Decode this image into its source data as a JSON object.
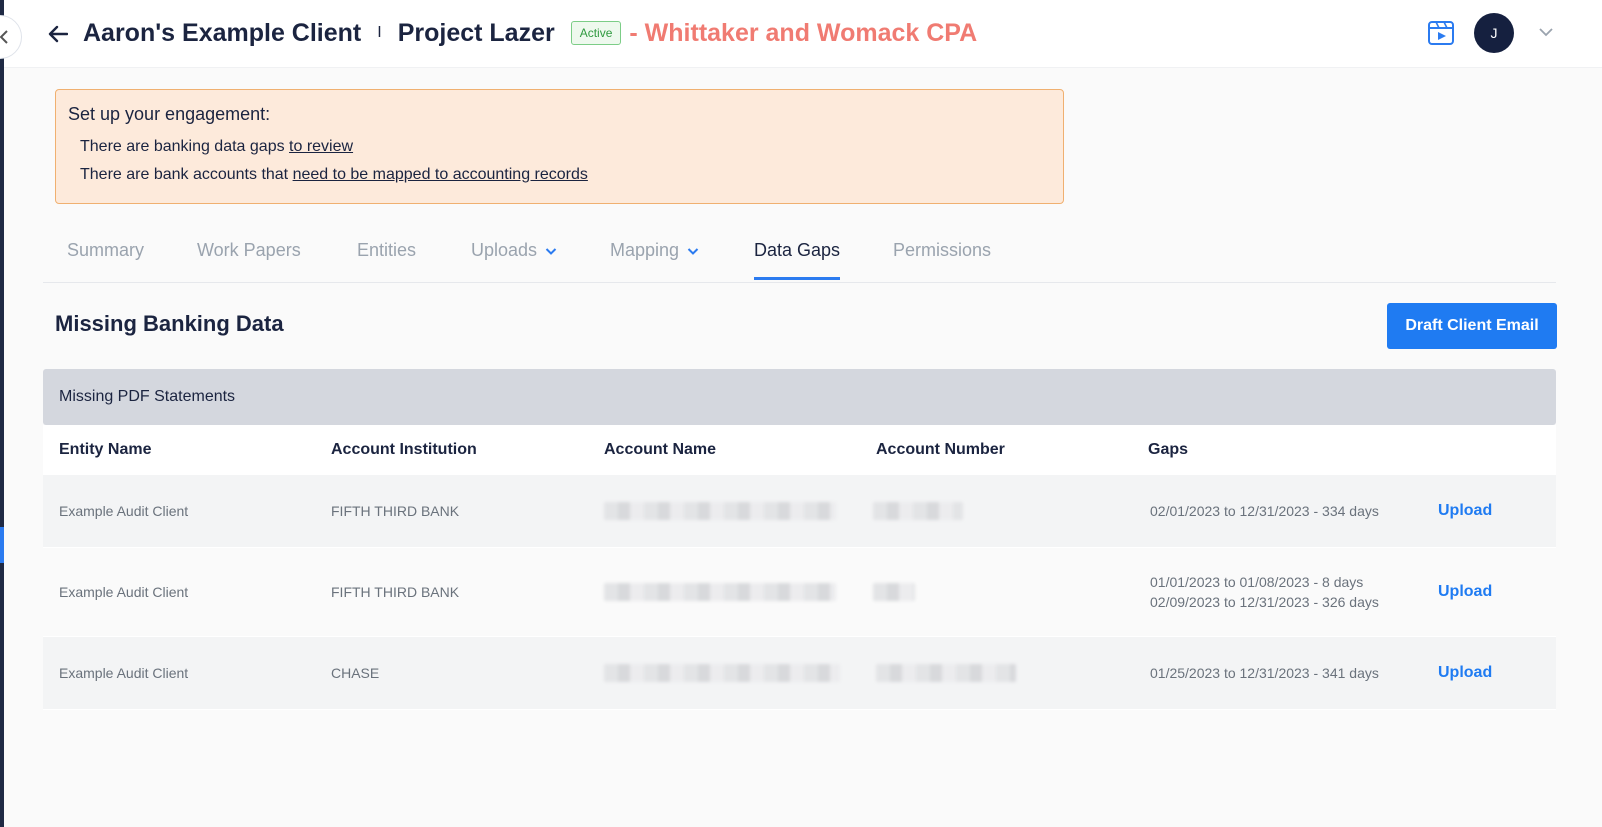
{
  "header": {
    "client_name": "Aaron's Example Client",
    "separator": "I",
    "project_name": "Project Lazer",
    "status": "Active",
    "firm_name": "- Whittaker and Womack CPA",
    "avatar_initial": "J"
  },
  "setup": {
    "title": "Set up your engagement:",
    "line1_prefix": "There are banking data gaps ",
    "line1_link": "to review",
    "line2_prefix": "There are bank accounts that ",
    "line2_link": "need to be mapped to accounting records"
  },
  "tabs": [
    {
      "label": "Summary"
    },
    {
      "label": "Work Papers"
    },
    {
      "label": "Entities"
    },
    {
      "label": "Uploads"
    },
    {
      "label": "Mapping"
    },
    {
      "label": "Data Gaps"
    },
    {
      "label": "Permissions"
    }
  ],
  "active_tab": "Data Gaps",
  "main": {
    "section_title": "Missing Banking Data",
    "draft_button": "Draft Client Email",
    "group_title": "Missing PDF Statements",
    "columns": [
      "Entity Name",
      "Account Institution",
      "Account Name",
      "Account Number",
      "Gaps"
    ],
    "rows": [
      {
        "entity": "Example Audit Client",
        "institution": "FIFTH THIRD BANK",
        "gaps": [
          "02/01/2023 to 12/31/2023 - 334 days"
        ],
        "action": "Upload"
      },
      {
        "entity": "Example Audit Client",
        "institution": "FIFTH THIRD BANK",
        "gaps": [
          "01/01/2023 to 01/08/2023 - 8 days",
          "02/09/2023 to 12/31/2023 - 326 days"
        ],
        "action": "Upload"
      },
      {
        "entity": "Example Audit Client",
        "institution": "CHASE",
        "gaps": [
          "01/25/2023 to 12/31/2023 - 341 days"
        ],
        "action": "Upload"
      }
    ]
  },
  "colors": {
    "accent": "#1f7bf2",
    "firm_name": "#f07b72",
    "alert_bg": "#fdeadb",
    "alert_border": "#f0b070",
    "active_badge": "#2f9a3f"
  }
}
